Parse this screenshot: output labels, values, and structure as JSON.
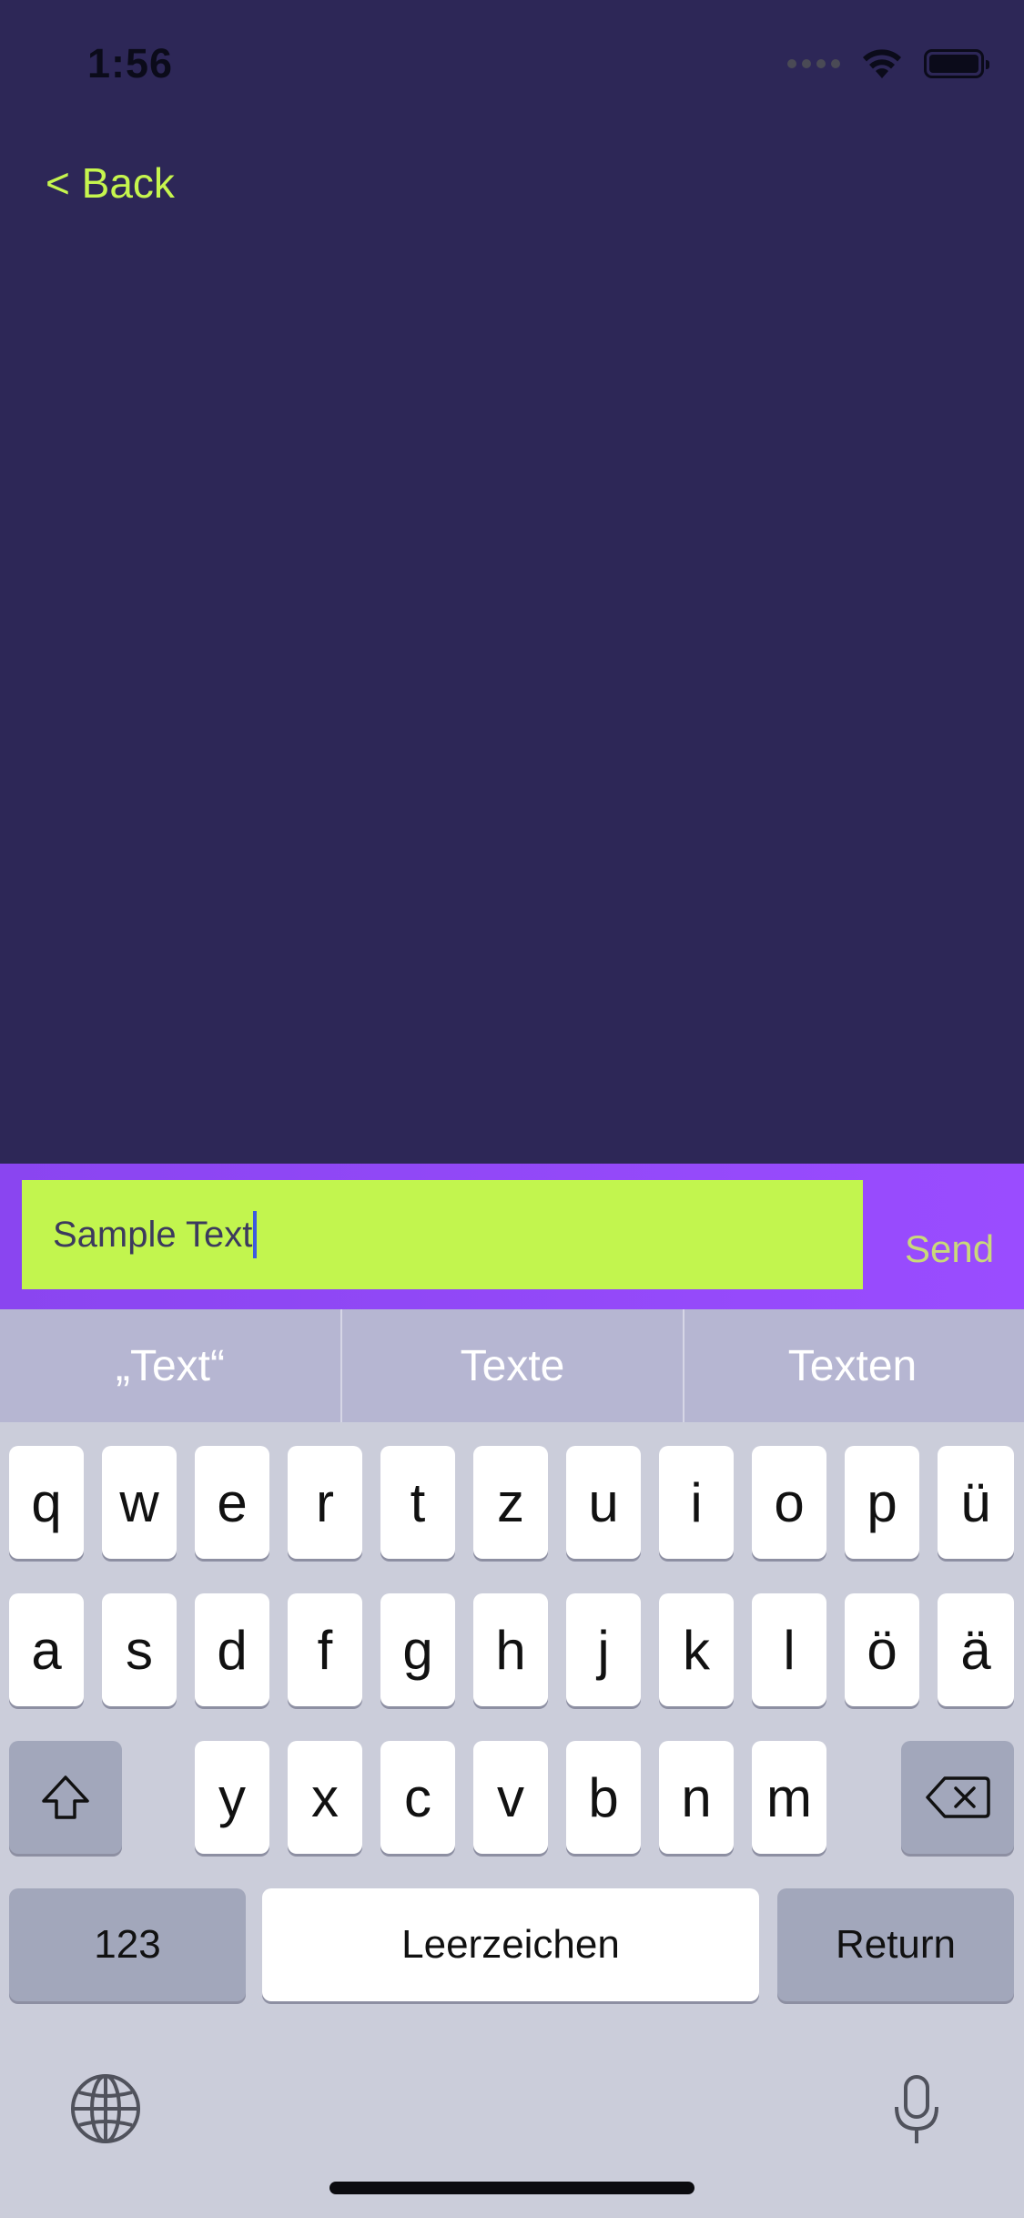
{
  "status_bar": {
    "time": "1:56"
  },
  "nav": {
    "back_label": "< Back"
  },
  "composer": {
    "input_value": "Sample Text",
    "send_label": "Send"
  },
  "keyboard": {
    "suggestions": [
      "„Text“",
      "Texte",
      "Texten"
    ],
    "row1": [
      "q",
      "w",
      "e",
      "r",
      "t",
      "z",
      "u",
      "i",
      "o",
      "p",
      "ü"
    ],
    "row2": [
      "a",
      "s",
      "d",
      "f",
      "g",
      "h",
      "j",
      "k",
      "l",
      "ö",
      "ä"
    ],
    "row3": [
      "y",
      "x",
      "c",
      "v",
      "b",
      "n",
      "m"
    ],
    "numbers_label": "123",
    "space_label": "Leerzeichen",
    "return_label": "Return"
  },
  "colors": {
    "background": "#2d2757",
    "accent": "#c2f54e",
    "bar": "#9a4cff"
  }
}
